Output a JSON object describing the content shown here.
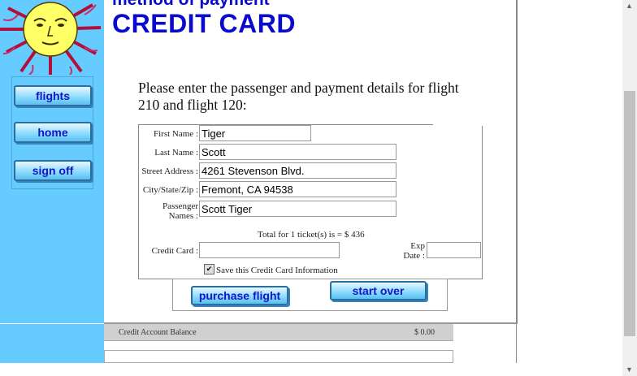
{
  "nav": {
    "flights": "flights",
    "home": "home",
    "signoff": "sign off"
  },
  "header": {
    "section": "method of payment",
    "title": "CREDIT CARD"
  },
  "intro": "Please enter the passenger and payment details for flight 210 and flight 120:",
  "form": {
    "first_name_label": "First Name :",
    "first_name": "Tiger",
    "last_name_label": "Last Name :",
    "last_name": "Scott",
    "street_label": "Street Address :",
    "street": "4261 Stevenson Blvd.",
    "city_label": "City/State/Zip :",
    "city": "Fremont, CA 94538",
    "passenger_label_1": "Passenger",
    "passenger_label_2": "Names :",
    "passenger": "Scott Tiger",
    "total": "Total for 1 ticket(s) is = $ 436",
    "cc_label": "Credit Card :",
    "cc_value": "",
    "exp_label_1": "Exp",
    "exp_label_2": "Date :",
    "exp_value": "",
    "save_label": "Save this Credit Card Information",
    "save_checked": true
  },
  "buttons": {
    "purchase": "purchase flight",
    "start_over": "start over"
  },
  "lower": {
    "balance_label": "Credit Account Balance",
    "balance_value": "$ 0.00"
  },
  "colors": {
    "sidebar": "#66ccff",
    "heading": "#0a0acc",
    "button_text": "#1515c8"
  }
}
